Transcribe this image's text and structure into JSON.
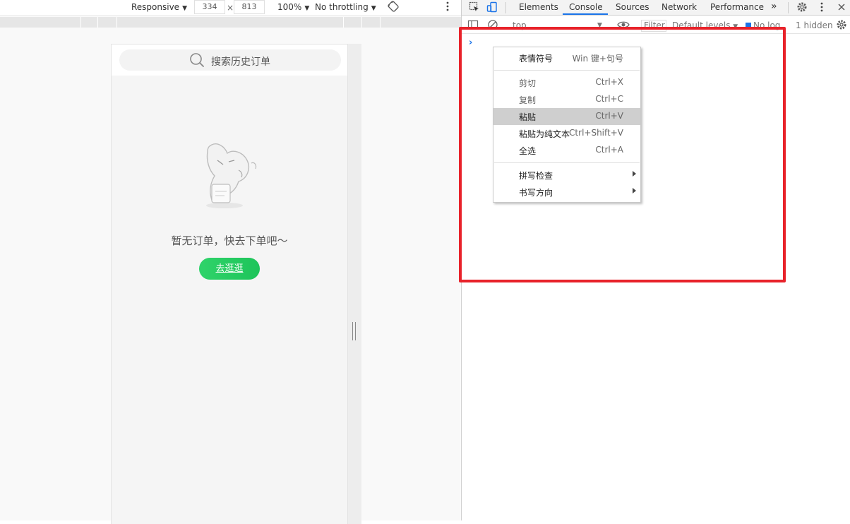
{
  "device_toolbar": {
    "device": "Responsive",
    "width": "334",
    "times": "×",
    "height": "813",
    "zoom": "100%",
    "throttle": "No throttling"
  },
  "app": {
    "search_placeholder": "搜索历史订单",
    "empty_text": "暂无订单，快去下单吧～",
    "go_button": "去逛逛",
    "illustration": "mascot-dog-icon"
  },
  "devtools": {
    "tabs": [
      "Elements",
      "Console",
      "Sources",
      "Network",
      "Performance"
    ],
    "active_tab": "Console",
    "more": "»",
    "console_toolbar": {
      "context": "top",
      "filter": "Filter",
      "levels": "Default levels",
      "group": "No log",
      "hidden": "1 hidden"
    },
    "prompt": "›"
  },
  "context_menu": {
    "items": [
      {
        "label": "表情符号",
        "shortcut": "Win 键+句号",
        "disabled": false
      },
      {
        "label": "剪切",
        "shortcut": "Ctrl+X",
        "disabled": true
      },
      {
        "label": "复制",
        "shortcut": "Ctrl+C",
        "disabled": true
      },
      {
        "label": "粘贴",
        "shortcut": "Ctrl+V",
        "disabled": false
      },
      {
        "label": "粘贴为纯文本",
        "shortcut": "Ctrl+Shift+V",
        "disabled": false
      },
      {
        "label": "全选",
        "shortcut": "Ctrl+A",
        "disabled": false
      },
      {
        "label": "拼写检查",
        "shortcut": "",
        "disabled": false
      },
      {
        "label": "书写方向",
        "shortcut": "",
        "disabled": false
      }
    ]
  },
  "colors": {
    "highlight_frame": "#e8222a",
    "accent": "#1a73e8",
    "button_green": "#22c95e"
  }
}
